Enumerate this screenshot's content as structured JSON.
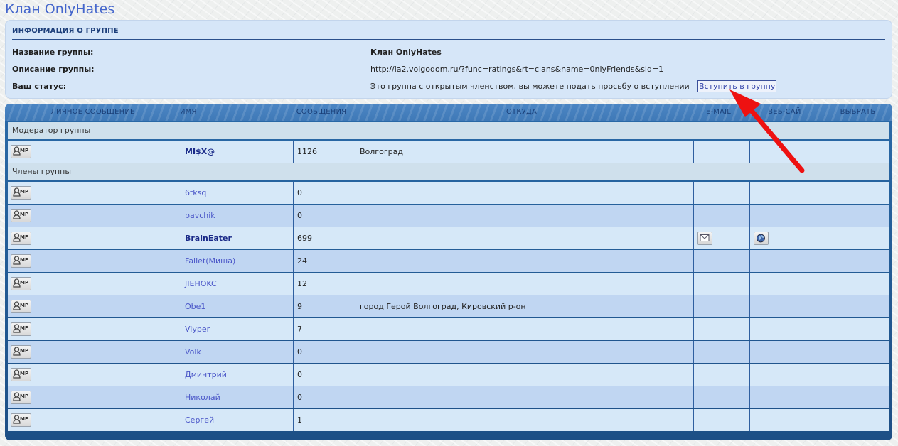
{
  "page": {
    "title": "Клан OnlyHates"
  },
  "info": {
    "heading": "ИНФОРМАЦИЯ О ГРУППЕ",
    "rows": [
      {
        "label": "Название группы:",
        "value": "Клан OnlyHates"
      },
      {
        "label": "Описание группы:",
        "value": "http://la2.volgodom.ru/?func=ratings&rt=clans&name=0nlyFriends&sid=1"
      },
      {
        "label": "Ваш статус:",
        "value": "Это группа с открытым членством, вы можете подать просьбу о вступлении"
      }
    ],
    "join_label": "Вступить в группу"
  },
  "table": {
    "columns": [
      "ЛИЧНОЕ СООБЩЕНИЕ",
      "ИМЯ",
      "СООБЩЕНИЯ",
      "ОТКУДА",
      "E-MAIL",
      "ВЕБ-САЙТ",
      "ВЫБРАТЬ"
    ],
    "pm_label": "MP",
    "sections": {
      "moderators": "Модератор группы",
      "members": "Члены группы"
    },
    "moderator": {
      "name": "MI$X@",
      "posts": "1126",
      "from": "Волгоград",
      "bold": true,
      "email": false,
      "www": false
    },
    "members": [
      {
        "name": "6tksq",
        "posts": "0",
        "from": "",
        "bold": false,
        "email": false,
        "www": false
      },
      {
        "name": "bavchik",
        "posts": "0",
        "from": "",
        "bold": false,
        "email": false,
        "www": false
      },
      {
        "name": "BrainEater",
        "posts": "699",
        "from": "",
        "bold": true,
        "email": true,
        "www": true
      },
      {
        "name": "Fallet(Миша)",
        "posts": "24",
        "from": "",
        "bold": false,
        "email": false,
        "www": false
      },
      {
        "name": "JIEHOKC",
        "posts": "12",
        "from": "",
        "bold": false,
        "email": false,
        "www": false
      },
      {
        "name": "Obe1",
        "posts": "9",
        "from": "город Герой Волгоград, Кировский р-он",
        "bold": false,
        "email": false,
        "www": false
      },
      {
        "name": "Viyper",
        "posts": "7",
        "from": "",
        "bold": false,
        "email": false,
        "www": false
      },
      {
        "name": "Volk",
        "posts": "0",
        "from": "",
        "bold": false,
        "email": false,
        "www": false
      },
      {
        "name": "Дминтрий",
        "posts": "0",
        "from": "",
        "bold": false,
        "email": false,
        "www": false
      },
      {
        "name": "Николай",
        "posts": "0",
        "from": "",
        "bold": false,
        "email": false,
        "www": false
      },
      {
        "name": "Сергей",
        "posts": "1",
        "from": "",
        "bold": false,
        "email": false,
        "www": false
      }
    ]
  },
  "colors": {
    "title": "#4466cc",
    "link": "#4a56c8",
    "row_odd": "#d6e8f8",
    "row_even": "#c0d6f2",
    "panel": "#245e98",
    "arrow": "#ee1111"
  }
}
